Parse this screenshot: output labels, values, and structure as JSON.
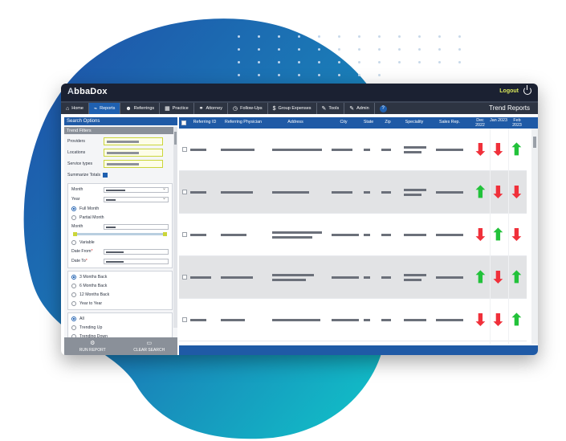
{
  "app": {
    "brand": "AbbaDox",
    "logout_label": "Logout"
  },
  "colors": {
    "topbar": "#1b2132",
    "accent": "#1f5aa6",
    "up_arrow": "#22c23a",
    "down_arrow": "#f0303a"
  },
  "nav": {
    "items": [
      {
        "label": "Home",
        "icon": "home-icon"
      },
      {
        "label": "Reports",
        "icon": "chart-icon"
      },
      {
        "label": "Referrings",
        "icon": "users-icon"
      },
      {
        "label": "Practice",
        "icon": "building-icon"
      },
      {
        "label": "Attorney",
        "icon": "handshake-icon"
      },
      {
        "label": "Follow-Ups",
        "icon": "clock-icon"
      },
      {
        "label": "Group Expenses",
        "icon": "dollar-icon"
      },
      {
        "label": "Tools",
        "icon": "wrench-icon"
      },
      {
        "label": "Admin",
        "icon": "wrench-icon"
      }
    ],
    "help": "?",
    "page_title": "Trend Reports"
  },
  "sidebar": {
    "header": "Search Options",
    "subheader": "Trend Filters",
    "fields": {
      "providers": "Providers",
      "locations": "Locations",
      "service_types": "Service types",
      "summarize_totals": "Summarize Totals"
    },
    "month_label": "Month",
    "year_label": "Year",
    "full_month": "Full Month",
    "partial_month": "Partial Month",
    "month2_label": "Month",
    "variable": "Variable",
    "date_from": "Date From",
    "date_to": "Date To",
    "periods": [
      "3 Months Back",
      "6 Months Back",
      "12 Months Back",
      "Year to Year"
    ],
    "trends": [
      "All",
      "Trending Up",
      "Trending Down"
    ],
    "run_report": "RUN REPORT",
    "clear_search": "CLEAR SEARCH"
  },
  "table": {
    "columns": [
      "Referring ID",
      "Referring Physician",
      "Address",
      "City",
      "State",
      "Zip",
      "Speciality",
      "Sales Rep."
    ],
    "month_columns": [
      "Dec 2022",
      "Jan 2023",
      "Feb 2023"
    ],
    "rows": [
      {
        "trend": [
          "down",
          "down",
          "up"
        ]
      },
      {
        "trend": [
          "up",
          "down",
          "down"
        ]
      },
      {
        "trend": [
          "down",
          "up",
          "down"
        ]
      },
      {
        "trend": [
          "up",
          "down",
          "up"
        ]
      },
      {
        "trend": [
          "down",
          "down",
          "up"
        ]
      }
    ]
  }
}
